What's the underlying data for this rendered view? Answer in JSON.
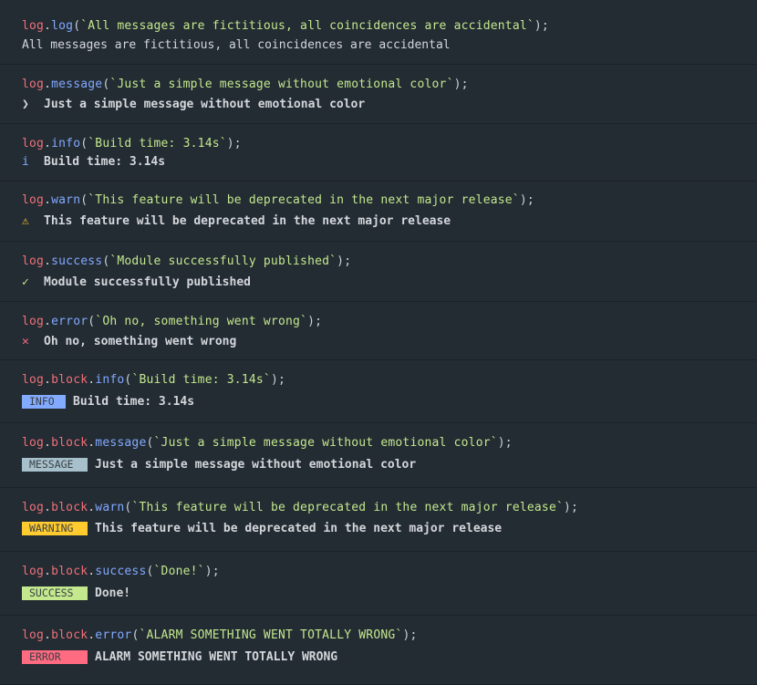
{
  "entries": [
    {
      "obj": "log",
      "method": "log",
      "arg": "`All messages are fictitious, all coincidences are accidental`",
      "icon": "",
      "output": "All messages are fictitious, all coincidences are accidental"
    },
    {
      "obj": "log",
      "method": "message",
      "arg": "`Just a simple message without emotional color`",
      "icon": "❯",
      "output": "Just a simple message without emotional color"
    },
    {
      "obj": "log",
      "method": "info",
      "arg": "`Build time: 3.14s`",
      "icon": "i",
      "output": "Build time: 3.14s"
    },
    {
      "obj": "log",
      "method": "warn",
      "arg": "`This feature will be deprecated in the next major release`",
      "icon": "⚠",
      "output": "This feature will be deprecated in the next major release"
    },
    {
      "obj": "log",
      "method": "success",
      "arg": "`Module successfully published`",
      "icon": "✓",
      "output": "Module successfully published"
    },
    {
      "obj": "log",
      "method": "error",
      "arg": "`Oh no, something went wrong`",
      "icon": "✕",
      "output": "Oh no, something went wrong"
    },
    {
      "obj": "log",
      "block": "block",
      "method": "info",
      "arg": "`Build time: 3.14s`",
      "badge": "INFO",
      "output": "Build time: 3.14s"
    },
    {
      "obj": "log",
      "block": "block",
      "method": "message",
      "arg": "`Just a simple message without emotional color`",
      "badge": "MESSAGE",
      "output": "Just a simple message without emotional color"
    },
    {
      "obj": "log",
      "block": "block",
      "method": "warn",
      "arg": "`This feature will be deprecated in the next major release`",
      "badge": "WARNING",
      "output": "This feature will be deprecated in the next major release"
    },
    {
      "obj": "log",
      "block": "block",
      "method": "success",
      "arg": "`Done!`",
      "badge": "SUCCESS",
      "output": "Done!"
    },
    {
      "obj": "log",
      "block": "block",
      "method": "error",
      "arg": "`ALARM SOMETHING WENT TOTALLY WRONG`",
      "badge": "ERROR",
      "output": "ALARM SOMETHING WENT TOTALLY WRONG"
    }
  ],
  "punct": {
    "dot": ".",
    "open": "(",
    "close": ");"
  },
  "colors": {
    "background": "#232b33",
    "object": "#f07178",
    "method": "#82aaff",
    "string": "#c3e88d",
    "info": "#82aaff",
    "message": "#a7c1cc",
    "warning": "#ffcb2e",
    "success": "#c3e88d",
    "error": "#ff6b81"
  },
  "icons": {
    "message": "chevron-right-icon",
    "info": "info-icon",
    "warn": "warning-triangle-icon",
    "success": "checkmark-icon",
    "error": "cross-icon"
  }
}
